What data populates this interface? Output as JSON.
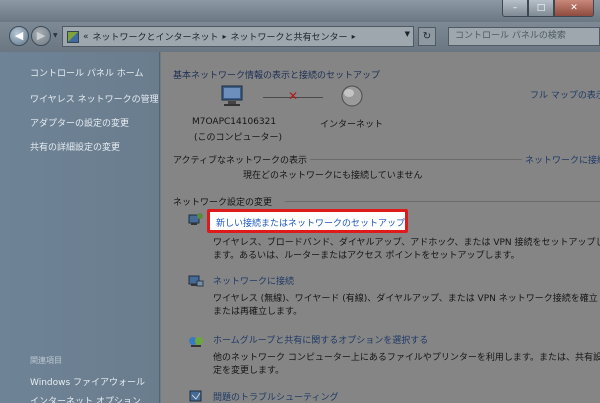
{
  "address_bar": {
    "segments": [
      "ネットワークとインターネット",
      "ネットワークと共有センター"
    ],
    "arrow": "▸",
    "leading": "«"
  },
  "search": {
    "placeholder": "コントロール パネルの検索"
  },
  "nav": {
    "back_glyph": "◀",
    "forward_glyph": "▶",
    "refresh_glyph": "↻"
  },
  "left_pane": {
    "links": [
      "コントロール パネル ホーム",
      "ワイヤレス ネットワークの管理",
      "アダプターの設定の変更",
      "共有の詳細設定の変更"
    ],
    "see_also_heading": "関連項目",
    "see_also": [
      "Windows ファイアウォール",
      "インターネット オプション"
    ]
  },
  "main": {
    "heading": "基本ネットワーク情報の表示と接続のセットアップ",
    "full_map_link": "フル マップの表示",
    "computer_name": "M7OAPC14106321",
    "computer_caption": "(このコンピューター)",
    "internet_label": "インターネット",
    "active_networks_label": "アクティブなネットワークの表示",
    "connect_link": "ネットワークに接続",
    "no_connection_text": "現在どのネットワークにも接続していません",
    "settings_heading": "ネットワーク設定の変更",
    "tasks": [
      {
        "title": "新しい接続またはネットワークのセットアップ",
        "desc1": "ワイヤレス、ブロードバンド、ダイヤルアップ、アドホック、または VPN 接続をセットアップし",
        "desc2": "ます。あるいは、ルーターまたはアクセス ポイントをセットアップします。"
      },
      {
        "title": "ネットワークに接続",
        "desc1": "ワイヤレス (無線)、ワイヤード (有線)、ダイヤルアップ、または VPN ネットワーク接続を確立",
        "desc2": "または再確立します。"
      },
      {
        "title": "ホームグループと共有に関するオプションを選択する",
        "desc1": "他のネットワーク コンピューター上にあるファイルやプリンターを利用します。または、共有設",
        "desc2": "定を変更します。"
      },
      {
        "title": "問題のトラブルシューティング",
        "desc1": "",
        "desc2": ""
      }
    ]
  },
  "colors": {
    "highlight_border": "#e01a1a",
    "link": "#1b56c0"
  }
}
